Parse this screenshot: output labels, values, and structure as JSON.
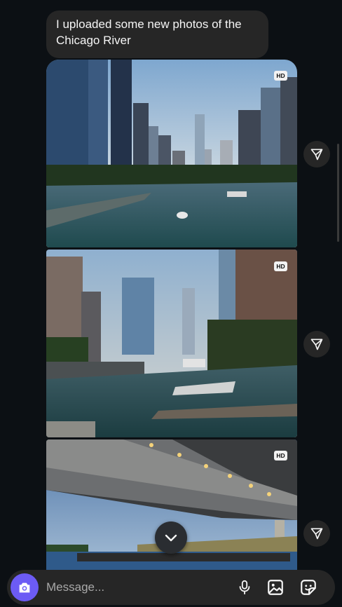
{
  "message": {
    "text": "I uploaded some new photos of the Chicago River"
  },
  "photos": [
    {
      "badge": "HD"
    },
    {
      "badge": "HD"
    },
    {
      "badge": "HD"
    }
  ],
  "composer": {
    "placeholder": "Message..."
  },
  "icons": {
    "share": "paper-plane-icon",
    "scroll_down": "chevron-down-icon",
    "camera": "camera-icon",
    "mic": "microphone-icon",
    "gallery": "gallery-icon",
    "sticker": "sticker-icon"
  },
  "colors": {
    "background": "#0c1014",
    "bubble": "#262626",
    "accent": "#6c5bf5"
  }
}
